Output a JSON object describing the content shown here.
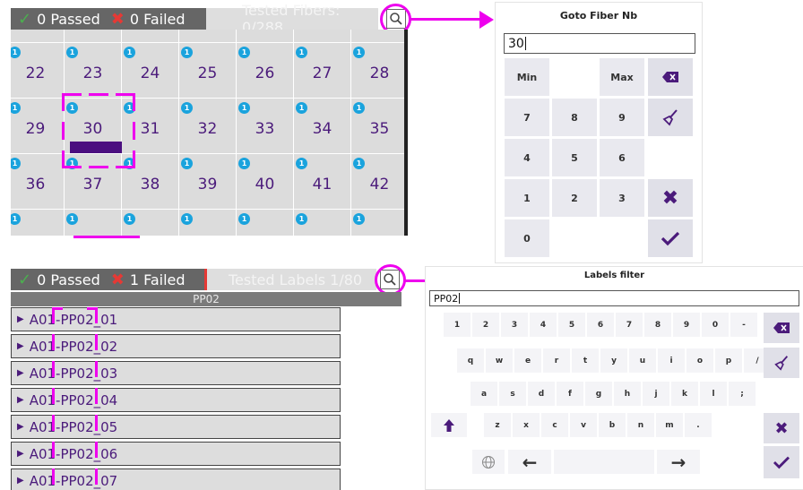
{
  "fiber_panel": {
    "passed_label": "0 Passed",
    "failed_label": "0 Failed",
    "tested_label": "Tested Fibers: 0/288",
    "badge": "1",
    "rows": [
      [
        "22",
        "23",
        "24",
        "25",
        "26",
        "27",
        "28"
      ],
      [
        "29",
        "30",
        "31",
        "32",
        "33",
        "34",
        "35"
      ],
      [
        "36",
        "37",
        "38",
        "39",
        "40",
        "41",
        "42"
      ]
    ]
  },
  "goto_dialog": {
    "title": "Goto Fiber Nb",
    "input_value": "30",
    "keys": {
      "min": "Min",
      "max": "Max",
      "k7": "7",
      "k8": "8",
      "k9": "9",
      "k4": "4",
      "k5": "5",
      "k6": "6",
      "k1": "1",
      "k2": "2",
      "k3": "3",
      "k0": "0"
    }
  },
  "labels_panel": {
    "passed_label": "0 Passed",
    "failed_label": "1 Failed",
    "tested_label": "Tested Labels 1/80",
    "group": "PP02",
    "items": [
      "A01-PP02_01",
      "A01-PP02_02",
      "A01-PP02_03",
      "A01-PP02_04",
      "A01-PP02_05",
      "A01-PP02_06",
      "A01-PP02_07"
    ]
  },
  "labels_filter": {
    "title": "Labels filter",
    "input_value": "PP02",
    "row1": [
      "1",
      "2",
      "3",
      "4",
      "5",
      "6",
      "7",
      "8",
      "9",
      "0",
      "-"
    ],
    "row2": [
      "q",
      "w",
      "e",
      "r",
      "t",
      "y",
      "u",
      "i",
      "o",
      "p",
      "/"
    ],
    "row3": [
      "a",
      "s",
      "d",
      "f",
      "g",
      "h",
      "j",
      "k",
      "l",
      ";"
    ],
    "row4": [
      "z",
      "x",
      "c",
      "v",
      "b",
      "n",
      "m",
      "."
    ]
  },
  "colors": {
    "accent": "#4b1b7b",
    "callout": "#ee00ee",
    "badge": "#1aa3dd",
    "ok": "#4caf50",
    "ko": "#e53935"
  }
}
